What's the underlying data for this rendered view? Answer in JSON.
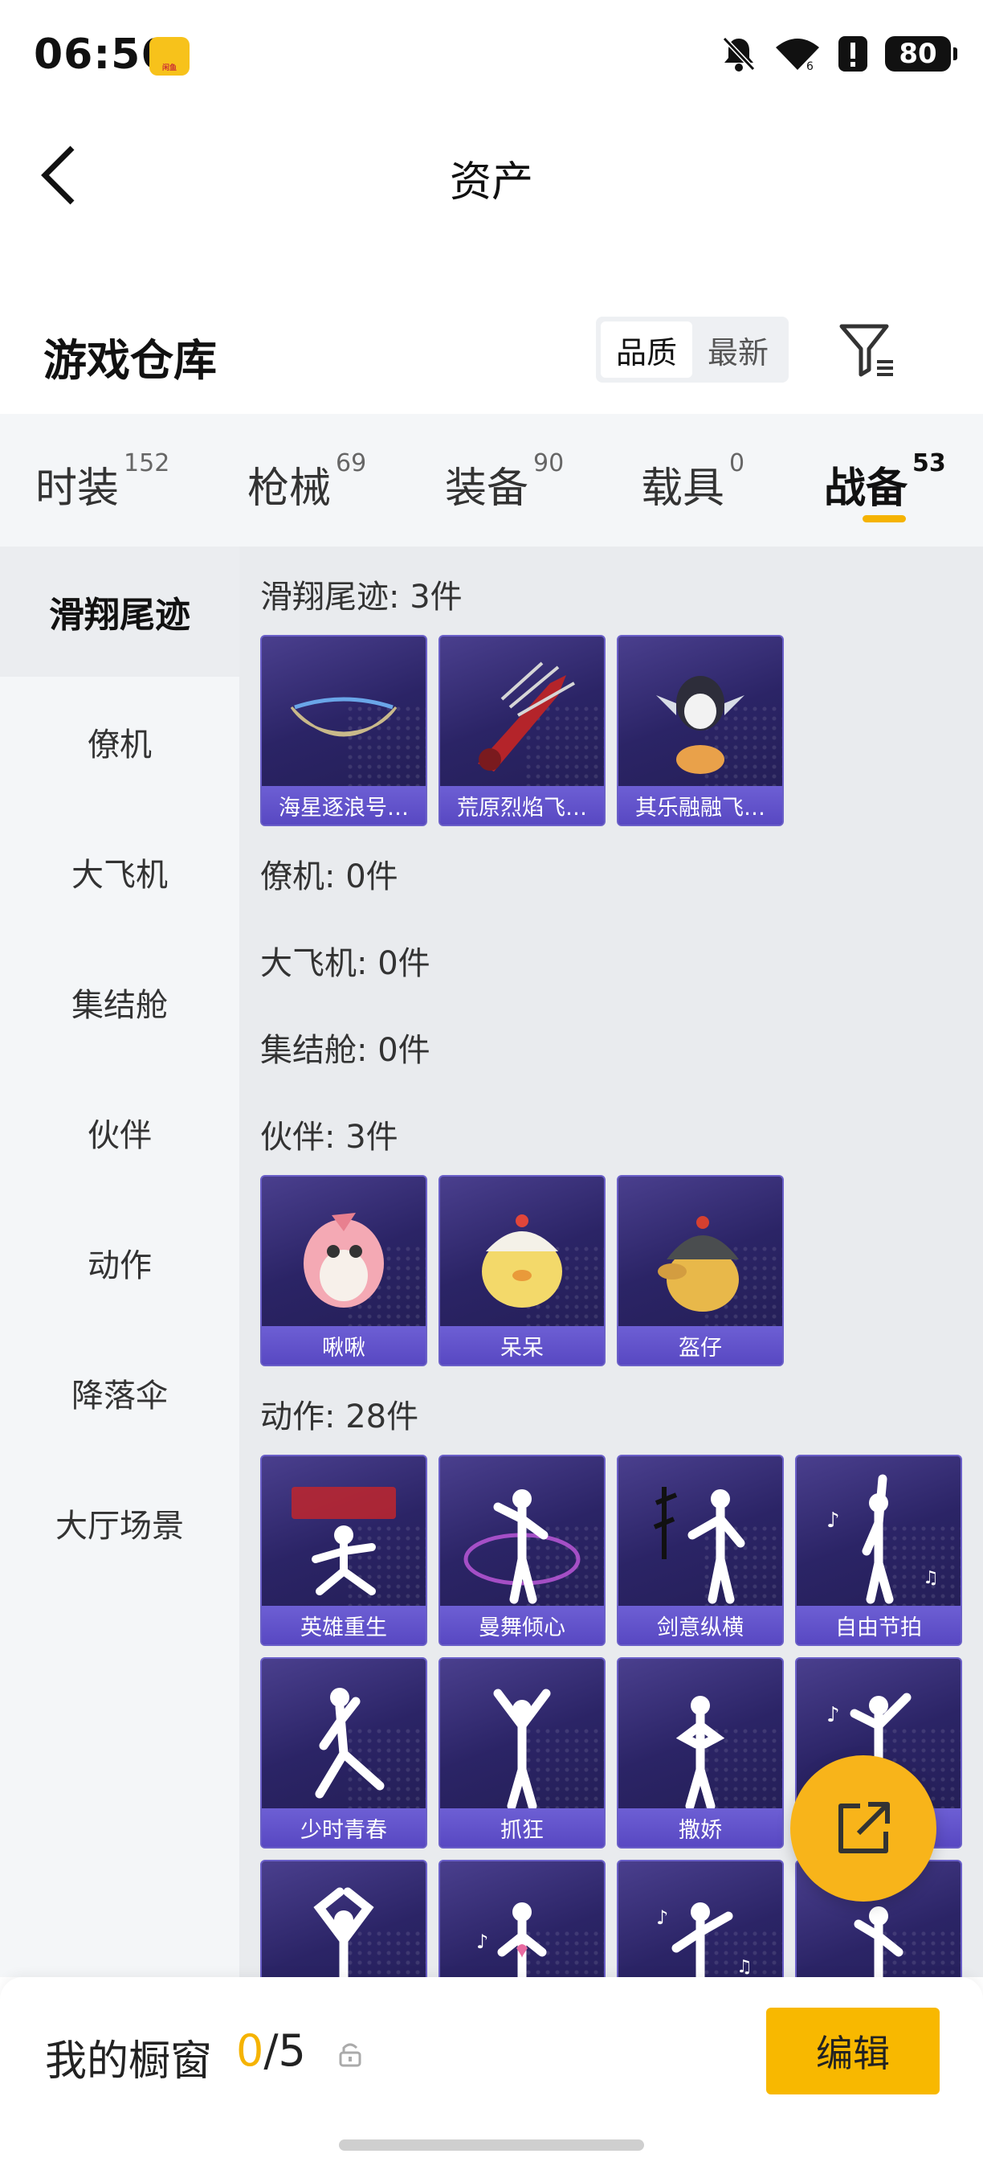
{
  "status_bar": {
    "time": "06:56",
    "battery": "80",
    "app_badge": "闲鱼"
  },
  "header": {
    "title": "资产"
  },
  "warehouse": {
    "title": "游戏仓库",
    "sort_options": [
      "品质",
      "最新"
    ],
    "active_sort": "品质"
  },
  "category_tabs": [
    {
      "label": "时装",
      "count": "152"
    },
    {
      "label": "枪械",
      "count": "69"
    },
    {
      "label": "装备",
      "count": "90"
    },
    {
      "label": "载具",
      "count": "0"
    },
    {
      "label": "战备",
      "count": "53"
    }
  ],
  "active_category": "战备",
  "sidebar": {
    "items": [
      "滑翔尾迹",
      "僚机",
      "大飞机",
      "集结舱",
      "伙伴",
      "动作",
      "降落伞",
      "大厅场景"
    ],
    "active": "滑翔尾迹"
  },
  "sections": [
    {
      "title": "滑翔尾迹: 3件",
      "items": [
        "海星逐浪号…",
        "荒原烈焰飞…",
        "其乐融融飞…"
      ]
    },
    {
      "title": "僚机: 0件",
      "items": []
    },
    {
      "title": "大飞机: 0件",
      "items": []
    },
    {
      "title": "集结舱: 0件",
      "items": []
    },
    {
      "title": "伙伴: 3件",
      "items": [
        "啾啾",
        "呆呆",
        "盔仔"
      ]
    },
    {
      "title": "动作: 28件",
      "items": [
        "英雄重生",
        "曼舞倾心",
        "剑意纵横",
        "自由节拍",
        "少时青春",
        "抓狂",
        "撒娇",
        "",
        "",
        "",
        "",
        ""
      ]
    }
  ],
  "showcase": {
    "label": "我的橱窗",
    "used": "0",
    "total": "/5"
  },
  "edit_label": "编辑",
  "colors": {
    "accent": "#f5b301",
    "card_dark": "#2b2466",
    "card_label": "#5848c2"
  }
}
